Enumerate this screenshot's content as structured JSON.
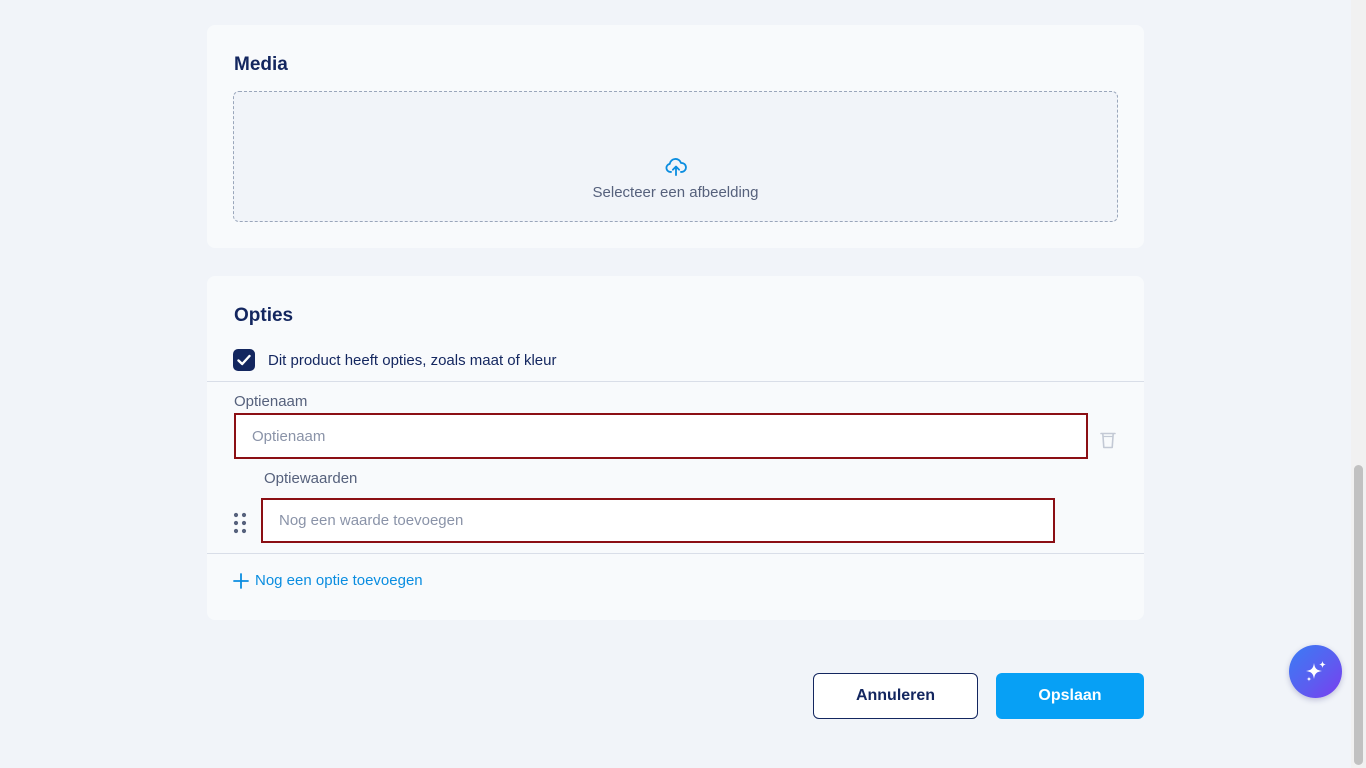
{
  "media": {
    "title": "Media",
    "dropzone_label": "Selecteer een afbeelding",
    "upload_icon": "cloud-upload-icon"
  },
  "options": {
    "title": "Opties",
    "has_options_label": "Dit product heeft opties, zoals maat of kleur",
    "has_options_checked": true,
    "option_name_label": "Optienaam",
    "option_name_placeholder": "Optienaam",
    "option_name_value": "",
    "option_values_label": "Optiewaarden",
    "option_value_placeholder": "Nog een waarde toevoegen",
    "option_value_value": "",
    "add_option_label": "Nog een optie toevoegen",
    "delete_icon": "trash-icon",
    "drag_icon": "drag-handle-icon"
  },
  "actions": {
    "cancel_label": "Annuleren",
    "save_label": "Opslaan"
  },
  "colors": {
    "primary_navy": "#13265f",
    "accent_blue": "#07a0f5",
    "link_blue": "#0a8de0",
    "error_border": "#8b0f14"
  }
}
